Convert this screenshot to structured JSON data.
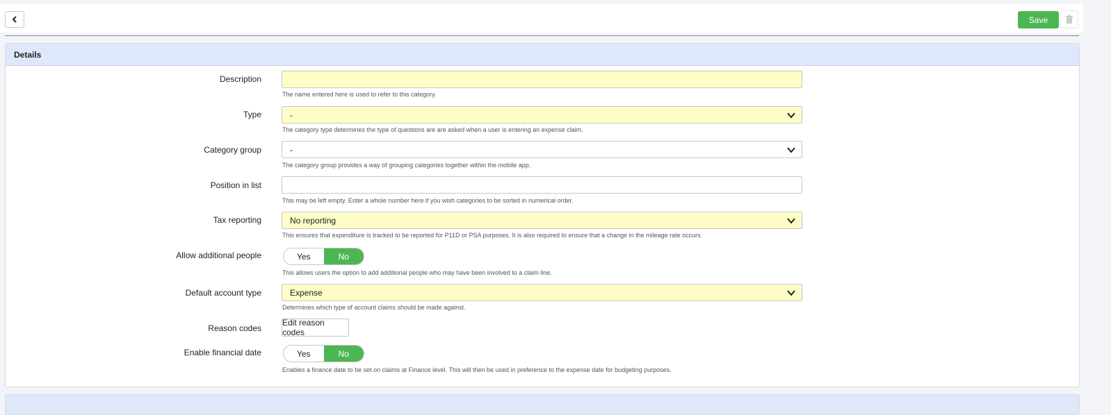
{
  "toolbar": {
    "back_icon": "chevron-left-icon",
    "save_label": "Save",
    "delete_icon": "trash-icon"
  },
  "section": {
    "title": "Details"
  },
  "form": {
    "description": {
      "label": "Description",
      "value": "",
      "hint": "The name entered here is used to refer to this category."
    },
    "type": {
      "label": "Type",
      "value": "-",
      "hint": "The category type determines the type of questions are are asked when a user is entering an expense claim."
    },
    "category_group": {
      "label": "Category group",
      "value": "-",
      "hint": "The category group provides a way of grouping categories together within the mobile app."
    },
    "position": {
      "label": "Position in list",
      "value": "",
      "hint": "This may be left empty. Enter a whole number here if you wish categories to be sorted in numerical order."
    },
    "tax_reporting": {
      "label": "Tax reporting",
      "value": "No reporting",
      "hint": "This ensures that expenditure is tracked to be reported for P11D or PSA purposes. It is also required to ensure that a change in the mileage rate occurs."
    },
    "allow_people": {
      "label": "Allow additional people",
      "yes": "Yes",
      "no": "No",
      "selected": "No",
      "hint": "This allows users the option to add additional people who may have been involved to a claim line."
    },
    "account_type": {
      "label": "Default account type",
      "value": "Expense",
      "hint": "Determines which type of account claims should be made against."
    },
    "reason_codes": {
      "label": "Reason codes",
      "button": "Edit reason codes"
    },
    "financial_date": {
      "label": "Enable financial date",
      "yes": "Yes",
      "no": "No",
      "selected": "No",
      "hint": "Enables a finance date to be set on claims at Finance level. This will then be used in preference to the expense date for budgeting purposes."
    }
  },
  "colors": {
    "accent_green": "#4cb752",
    "required_field": "#fefdc8",
    "section_header": "#dfe8fb"
  }
}
